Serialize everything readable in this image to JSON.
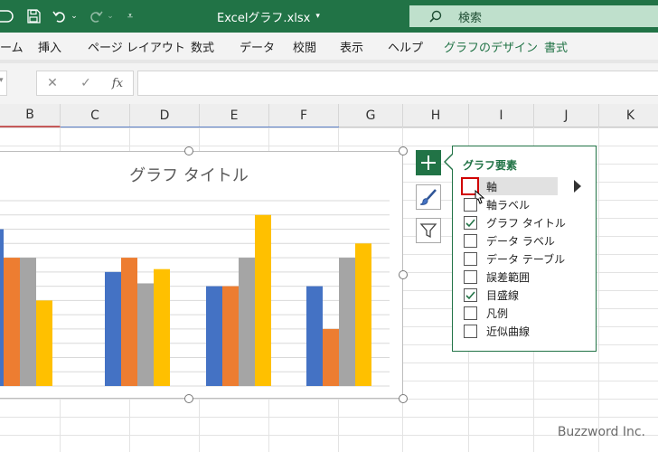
{
  "titlebar": {
    "file_title": "Excelグラフ.xlsx",
    "search_label": "検索"
  },
  "ribbon": {
    "tabs": [
      "ーム",
      "挿入",
      "ページ レイアウト",
      "数式",
      "データ",
      "校閲",
      "表示",
      "ヘルプ",
      "グラフのデザイン",
      "書式"
    ]
  },
  "formula_bar": {
    "fx_label": "fx"
  },
  "columns": [
    "B",
    "C",
    "D",
    "E",
    "F",
    "G",
    "H",
    "I",
    "J",
    "K"
  ],
  "chart": {
    "chart_data": {
      "type": "bar",
      "title": "グラフ タイトル",
      "categories": [
        "",
        "",
        "",
        ""
      ],
      "series": [
        {
          "values": [
            5.5,
            4.0,
            3.5,
            3.5
          ],
          "color": "#4472c4"
        },
        {
          "values": [
            4.5,
            4.5,
            3.5,
            2.0
          ],
          "color": "#ed7d31"
        },
        {
          "values": [
            4.5,
            3.6,
            4.5,
            4.5
          ],
          "color": "#a5a5a5"
        },
        {
          "values": [
            3.0,
            4.1,
            6.0,
            5.0
          ],
          "color": "#ffc000"
        }
      ],
      "ylim": [
        0,
        6.5
      ],
      "grid": true,
      "legend": "none"
    }
  },
  "chart_elements_panel": {
    "title": "グラフ要素",
    "items": [
      {
        "label": "軸",
        "checked": false
      },
      {
        "label": "軸ラベル",
        "checked": false
      },
      {
        "label": "グラフ タイトル",
        "checked": true
      },
      {
        "label": "データ ラベル",
        "checked": false
      },
      {
        "label": "データ テーブル",
        "checked": false
      },
      {
        "label": "誤差範囲",
        "checked": false
      },
      {
        "label": "目盛線",
        "checked": true
      },
      {
        "label": "凡例",
        "checked": false
      },
      {
        "label": "近似曲線",
        "checked": false
      }
    ]
  },
  "watermark": "Buzzword Inc.",
  "colors": {
    "excel_green": "#217346"
  }
}
